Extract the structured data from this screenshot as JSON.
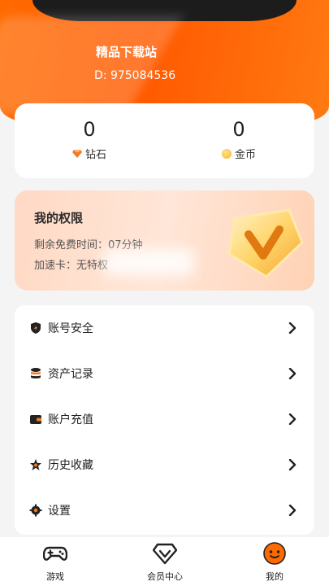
{
  "header": {
    "site_name": "精品下载站",
    "user_id_text": "D: 975084536"
  },
  "stats": {
    "diamond": {
      "value": "0",
      "label": "钻石",
      "icon": "diamond-icon"
    },
    "coin": {
      "value": "0",
      "label": "金币",
      "icon": "coin-icon"
    }
  },
  "privileges": {
    "title": "我的权限",
    "free_time": "剩余免费时间：07分钟",
    "accel_card": "加速卡：无特权"
  },
  "menu": {
    "items": [
      {
        "label": "账号安全",
        "icon": "shield-icon"
      },
      {
        "label": "资产记录",
        "icon": "database-icon"
      },
      {
        "label": "账户充值",
        "icon": "wallet-icon"
      },
      {
        "label": "历史收藏",
        "icon": "star-icon"
      },
      {
        "label": "设置",
        "icon": "gear-icon"
      }
    ]
  },
  "tabbar": {
    "tabs": [
      {
        "label": "游戏",
        "icon": "gamepad-icon"
      },
      {
        "label": "会员中心",
        "icon": "vip-diamond-icon"
      },
      {
        "label": "我的",
        "icon": "profile-face-icon"
      }
    ]
  },
  "colors": {
    "brand_orange": "#ff6300",
    "card_bg": "#ffffff",
    "page_bg": "#f4f4f4"
  }
}
